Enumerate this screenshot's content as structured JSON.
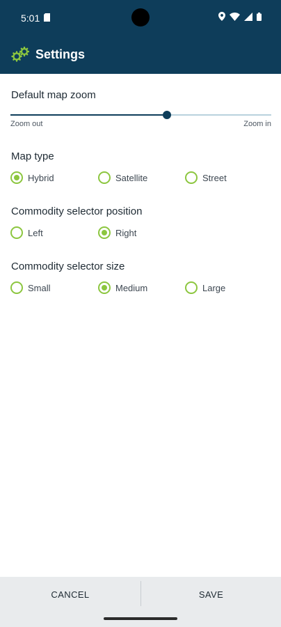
{
  "status_bar": {
    "time": "5:01",
    "icons": [
      "sd-card-icon",
      "location-icon",
      "wifi-icon",
      "signal-icon",
      "battery-icon"
    ]
  },
  "app_bar": {
    "icon": "gears-icon",
    "title": "Settings"
  },
  "zoom": {
    "title": "Default map zoom",
    "min_label": "Zoom out",
    "max_label": "Zoom in",
    "value_fraction": 0.6
  },
  "map_type": {
    "title": "Map type",
    "options": [
      "Hybrid",
      "Satellite",
      "Street"
    ],
    "selected": "Hybrid"
  },
  "selector_position": {
    "title": "Commodity selector position",
    "options": [
      "Left",
      "Right"
    ],
    "selected": "Right"
  },
  "selector_size": {
    "title": "Commodity selector size",
    "options": [
      "Small",
      "Medium",
      "Large"
    ],
    "selected": "Medium"
  },
  "footer": {
    "cancel_label": "CANCEL",
    "save_label": "SAVE"
  },
  "colors": {
    "primary": "#0e3d5a",
    "accent": "#8cc63f"
  }
}
